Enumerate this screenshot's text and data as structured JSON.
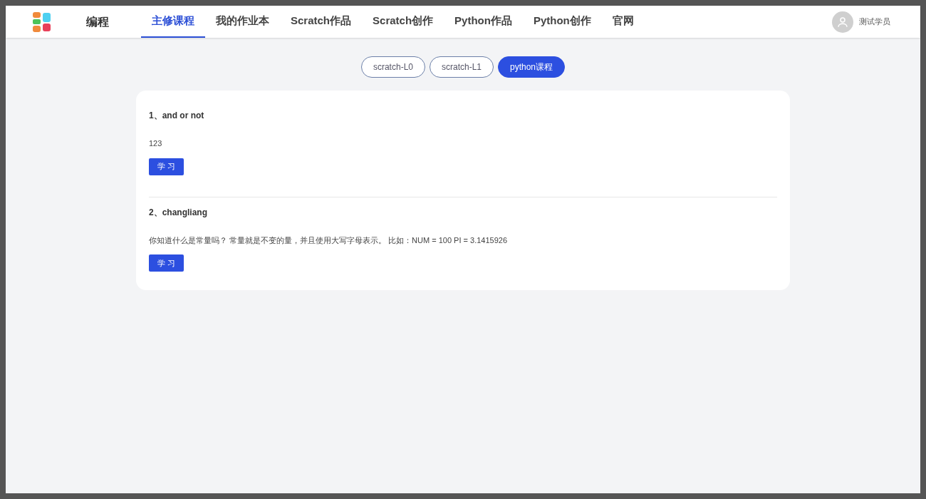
{
  "header": {
    "brand": "编程",
    "nav": [
      {
        "label": "主修课程",
        "selected": true
      },
      {
        "label": "我的作业本",
        "selected": false
      },
      {
        "label": "Scratch作品",
        "selected": false
      },
      {
        "label": "Scratch创作",
        "selected": false
      },
      {
        "label": "Python作品",
        "selected": false
      },
      {
        "label": "Python创作",
        "selected": false
      },
      {
        "label": "官网",
        "selected": false
      }
    ],
    "user": "测试学员"
  },
  "course_tabs": [
    {
      "label": "scratch-L0",
      "selected": false
    },
    {
      "label": "scratch-L1",
      "selected": false
    },
    {
      "label": "python课程",
      "selected": true
    }
  ],
  "lessons": [
    {
      "title": "1、and or not",
      "description": "123",
      "button": "学 习"
    },
    {
      "title": "2、changliang",
      "description": "你知道什么是常量吗？ 常量就是不变的量，并且使用大写字母表示。 比如：NUM = 100 PI = 3.1415926",
      "button": "学 习"
    }
  ]
}
